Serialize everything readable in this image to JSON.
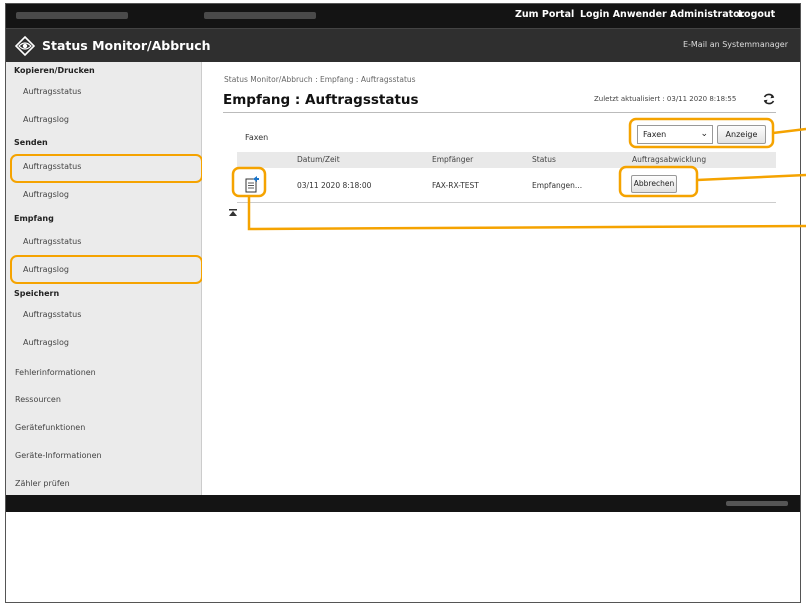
{
  "topbar": {
    "portal_link": "Zum Portal",
    "login_label": "Login Anwender :",
    "login_user": "Administrator",
    "logout": "Logout"
  },
  "header": {
    "title": "Status Monitor/Abbruch",
    "mail_link": "E-Mail an Systemmanager"
  },
  "sidebar": {
    "groups": [
      {
        "heading": "Kopieren/Drucken",
        "items": [
          "Auftragsstatus",
          "Auftragslog"
        ]
      },
      {
        "heading": "Senden",
        "items": [
          "Auftragsstatus",
          "Auftragslog"
        ]
      },
      {
        "heading": "Empfang",
        "items": [
          "Auftragsstatus",
          "Auftragslog"
        ]
      },
      {
        "heading": "Speichern",
        "items": [
          "Auftragsstatus",
          "Auftragslog"
        ]
      }
    ],
    "main_items": [
      "Fehlerinformationen",
      "Ressourcen",
      "Gerätefunktionen",
      "Geräte-Informationen",
      "Zähler prüfen"
    ]
  },
  "main": {
    "breadcrumb": "Status Monitor/Abbruch : Empfang : Auftragsstatus",
    "title": "Empfang : Auftragsstatus",
    "last_update": "Zuletzt aktualisiert : 03/11 2020 8:18:55",
    "filter_label": "Faxen",
    "filter_value": "Faxen",
    "display_button": "Anzeige",
    "table": {
      "headers": [
        "Datum/Zeit",
        "Empfänger",
        "Status",
        "Auftragsabwicklung"
      ],
      "rows": [
        {
          "datetime": "03/11 2020 8:18:00",
          "recipient": "FAX-RX-TEST",
          "status": "Empfangen...",
          "action": "Abbrechen"
        }
      ]
    }
  },
  "colors": {
    "highlight": "#f5a300",
    "topbar": "#141414",
    "titlebar": "#2f2f2f",
    "sidebar": "#ebebeb"
  }
}
